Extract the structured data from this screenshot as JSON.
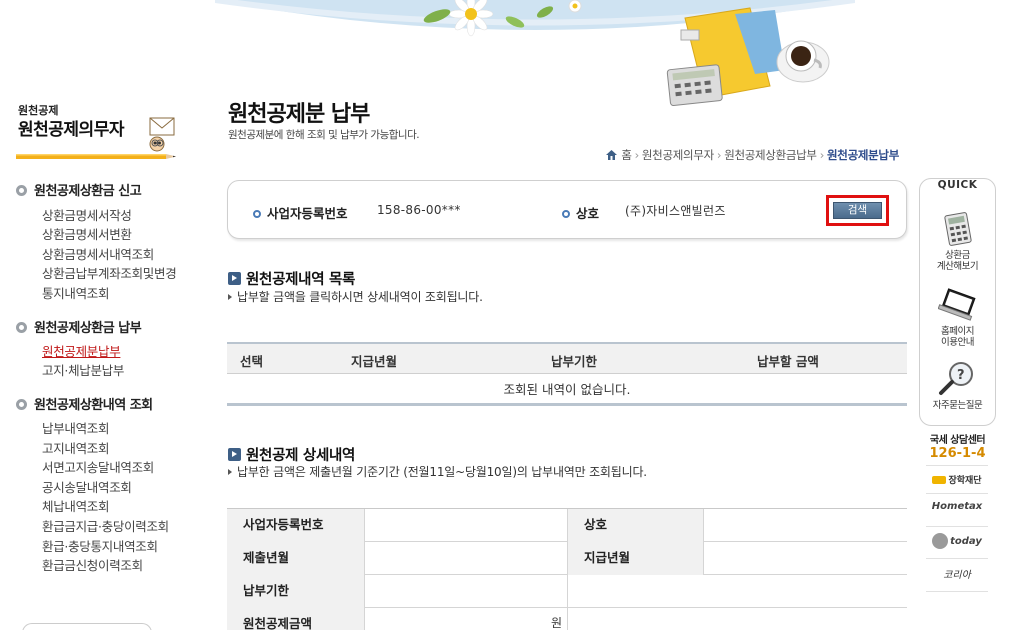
{
  "sidebar": {
    "title_small": "원천공제",
    "title_big": "원천공제의무자",
    "sections": [
      {
        "heading": "원천공제상환금 신고",
        "items": [
          "상환금명세서작성",
          "상환금명세서변환",
          "상환금명세서내역조회",
          "상환금납부계좌조회및변경",
          "통지내역조회"
        ]
      },
      {
        "heading": "원천공제상환금 납부",
        "items": [
          "원천공제분납부",
          "고지·체납분납부"
        ]
      },
      {
        "heading": "원천공제상환내역 조회",
        "items": [
          "납부내역조회",
          "고지내역조회",
          "서면고지송달내역조회",
          "공시송달내역조회",
          "체납내역조회",
          "환급금지급·충당이력조회",
          "환급·충당통지내역조회",
          "환급금신청이력조회"
        ]
      }
    ]
  },
  "page": {
    "title": "원천공제분 납부",
    "subtitle": "원천공제분에 한해 조회 및 납부가 가능합니다."
  },
  "breadcrumb": [
    "홈",
    "원천공제의무자",
    "원천공제상환금납부",
    "원천공제분납부"
  ],
  "search": {
    "biz_label": "사업자등록번호",
    "biz_value": "158-86-00***",
    "name_label": "상호",
    "name_value": "(주)자비스앤빌런즈",
    "button_label": "검색"
  },
  "list_section": {
    "heading": "원천공제내역 목록",
    "note": "납부할 금액을 클릭하시면 상세내역이 조회됩니다.",
    "columns": [
      "선택",
      "지급년월",
      "납부기한",
      "납부할 금액"
    ],
    "empty_message": "조회된 내역이 없습니다."
  },
  "detail_section": {
    "heading": "원천공제 상세내역",
    "note": "납부한 금액은 제출년월 기준기간 (전월11일~당월10일)의 납부내역만 조회됩니다.",
    "rows": {
      "biz_no": "사업자등록번호",
      "company": "상호",
      "submit_month": "제출년월",
      "pay_month": "지급년월",
      "due_date": "납부기한",
      "amount": "원천공제금액",
      "amount_unit": "원"
    }
  },
  "quick": {
    "title": "QUICK",
    "items": [
      {
        "label_line1": "상환금",
        "label_line2": "계산해보기",
        "icon": "calculator-icon"
      },
      {
        "label_line1": "홈페이지",
        "label_line2": "이용안내",
        "icon": "notebook-icon"
      },
      {
        "label_line1": "자주묻는질문",
        "label_line2": "",
        "icon": "magnifier-question-icon"
      }
    ],
    "center_label": "국세 상담센터",
    "center_phone": "126-1-4",
    "links": [
      "장학재단",
      "Hometax",
      "today",
      "코리아"
    ]
  },
  "colors": {
    "active_menu": "#c01818",
    "breadcrumb_current": "#2f4d8c",
    "search_highlight": "#e01010",
    "phone": "#d58a00"
  }
}
